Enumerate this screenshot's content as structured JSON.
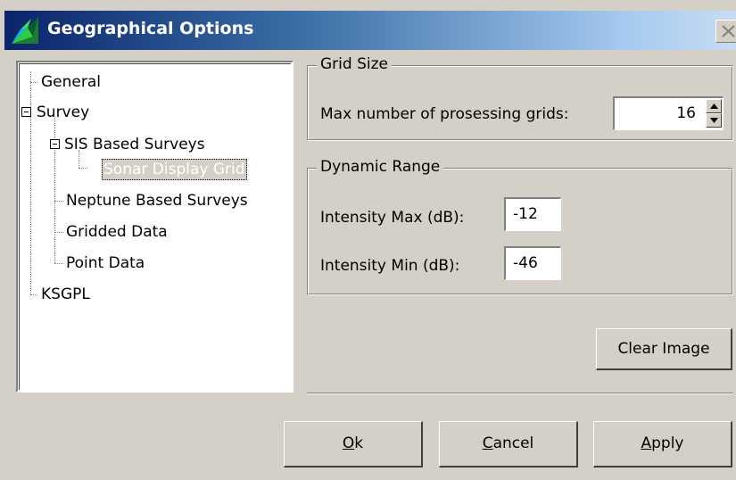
{
  "window": {
    "title": "Geographical Options"
  },
  "tree": {
    "general": "General",
    "survey": "Survey",
    "sis_based": "SIS Based Surveys",
    "sonar_display_grid": "Sonar Display Grid",
    "neptune_based": "Neptune Based Surveys",
    "gridded_data": "Gridded Data",
    "point_data": "Point Data",
    "ksgpl": "KSGPL"
  },
  "grid_size": {
    "title": "Grid Size",
    "max_grids_label": "Max number of prosessing grids:",
    "max_grids_value": "16"
  },
  "dynamic_range": {
    "title": "Dynamic Range",
    "max_label": "Intensity Max (dB):",
    "max_value": "-12",
    "min_label": "Intensity Min (dB):",
    "min_value": "-46"
  },
  "buttons": {
    "clear_image": "Clear Image",
    "ok_mnemonic": "O",
    "ok_rest": "k",
    "cancel_mnemonic": "C",
    "cancel_rest": "ancel",
    "apply_mnemonic": "A",
    "apply_rest": "pply"
  },
  "colors": {
    "title_start": "#0a246a",
    "title_end": "#c7dcf2",
    "face": "#d4d0c8"
  }
}
